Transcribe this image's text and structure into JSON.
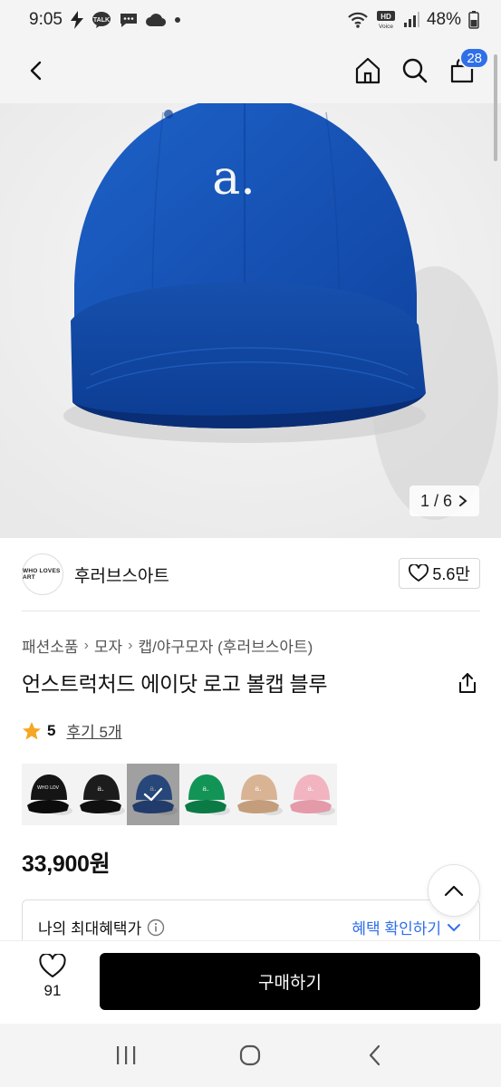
{
  "status_bar": {
    "time": "9:05",
    "talk_badge": "TALK",
    "hd_badge": "HD",
    "voice_badge": "Voice",
    "battery": "48%"
  },
  "header": {
    "cart_count": "28"
  },
  "gallery": {
    "counter": "1 / 6",
    "logo_text": "a."
  },
  "brand": {
    "logo_text": "WHO LOVES ART",
    "name": "후러브스아트",
    "likes": "5.6만"
  },
  "breadcrumb": [
    "패션소품",
    "모자",
    "캡/야구모자 (후러브스아트)"
  ],
  "product": {
    "title": "언스트럭처드 에이닷 로고 볼캡 블루",
    "price": "33,900원"
  },
  "rating": {
    "score": "5",
    "reviews": "후기 5개"
  },
  "swatches": [
    {
      "color": "#151515",
      "label": "WHO LOV"
    },
    {
      "color": "#1c1c1c",
      "label": "a."
    },
    {
      "color": "#1650ad",
      "label": "a."
    },
    {
      "color": "#129456",
      "label": "a."
    },
    {
      "color": "#d8b494",
      "label": "a."
    },
    {
      "color": "#f2b4c0",
      "label": "a."
    }
  ],
  "benefit": {
    "label": "나의 최대혜택가",
    "action": "혜택 확인하기"
  },
  "bottom": {
    "wish_count": "91",
    "buy_label": "구매하기"
  },
  "colors": {
    "accent": "#2f6fe8",
    "buy_button": "#000000",
    "star": "#f5a623",
    "hat": "#1650ad"
  }
}
